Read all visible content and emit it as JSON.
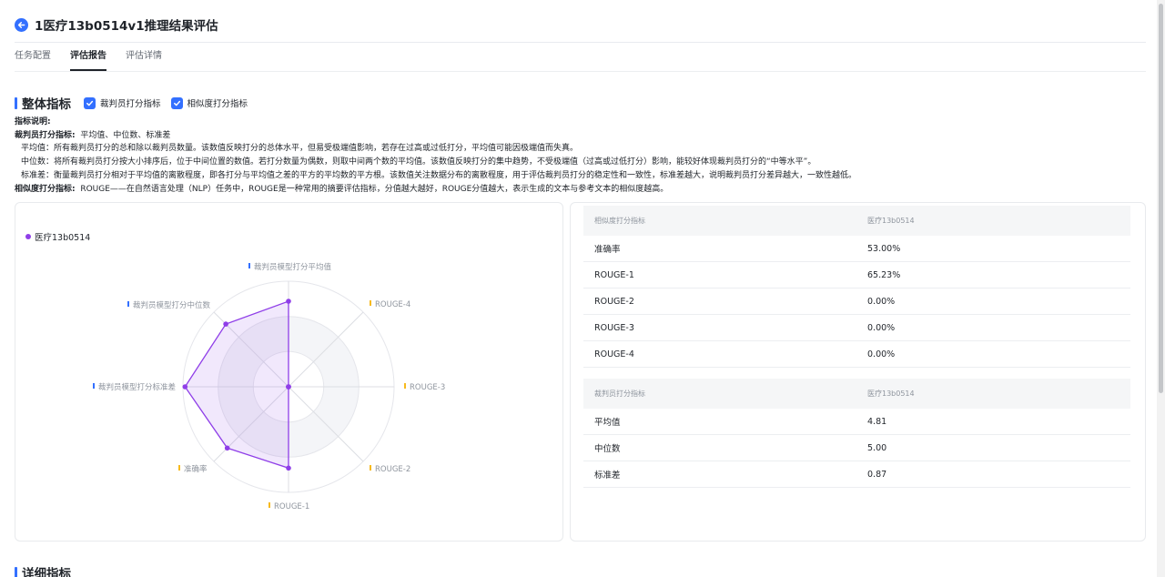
{
  "header": {
    "title": "1医疗13b0514v1推理结果评估"
  },
  "tabs": [
    {
      "label": "任务配置",
      "active": false
    },
    {
      "label": "评估报告",
      "active": true
    },
    {
      "label": "评估详情",
      "active": false
    }
  ],
  "overall": {
    "title": "整体指标",
    "checkboxes": [
      {
        "label": "裁判员打分指标",
        "checked": true
      },
      {
        "label": "相似度打分指标",
        "checked": true
      }
    ]
  },
  "description": {
    "heading": "指标说明:",
    "judge_title": "裁判员打分指标:",
    "judge_list": "平均值、中位数、标准差",
    "mean": "平均值：所有裁判员打分的总和除以裁判员数量。该数值反映打分的总体水平，但易受极端值影响，若存在过高或过低打分，平均值可能因极端值而失真。",
    "median": "中位数：将所有裁判员打分按大小排序后，位于中间位置的数值。若打分数量为偶数，则取中间两个数的平均值。该数值反映打分的集中趋势，不受极端值（过高或过低打分）影响，能较好体现裁判员打分的“中等水平”。",
    "std": "标准差：衡量裁判员打分相对于平均值的离散程度，即各打分与平均值之差的平方的平均数的平方根。该数值关注数据分布的离散程度，用于评估裁判员打分的稳定性和一致性，标准差越大，说明裁判员打分差异越大，一致性越低。",
    "sim_title": "相似度打分指标:",
    "sim_text": "ROUGE——在自然语言处理（NLP）任务中，ROUGE是一种常用的摘要评估指标，分值越大越好，ROUGE分值越大，表示生成的文本与参考文本的相似度越高。"
  },
  "radar": {
    "legend": "医疗13b0514",
    "labels": {
      "mean": "裁判员模型打分平均值",
      "rouge4": "ROUGE-4",
      "rouge3": "ROUGE-3",
      "rouge2": "ROUGE-2",
      "rouge1": "ROUGE-1",
      "acc": "准确率",
      "std": "裁判员模型打分标准差",
      "median": "裁判员模型打分中位数"
    },
    "series_color": "#8f3ee8",
    "judge_color": "#3370ff",
    "sim_color": "#f7ba1e"
  },
  "chart_data": {
    "type": "radar",
    "categories": [
      "裁判员模型打分平均值",
      "ROUGE-4",
      "ROUGE-3",
      "ROUGE-2",
      "ROUGE-1",
      "准确率",
      "裁判员模型打分标准差",
      "裁判员模型打分中位数"
    ],
    "series": [
      {
        "name": "医疗13b0514",
        "values": [
          0.81,
          0.0,
          0.0,
          0.0,
          0.77,
          0.82,
          0.98,
          0.84
        ]
      }
    ],
    "rlim": [
      0,
      1
    ]
  },
  "similarity_table": {
    "headers": [
      "相似度打分指标",
      "医疗13b0514"
    ],
    "rows": [
      [
        "准确率",
        "53.00%"
      ],
      [
        "ROUGE-1",
        "65.23%"
      ],
      [
        "ROUGE-2",
        "0.00%"
      ],
      [
        "ROUGE-3",
        "0.00%"
      ],
      [
        "ROUGE-4",
        "0.00%"
      ]
    ]
  },
  "judge_table": {
    "headers": [
      "裁判员打分指标",
      "医疗13b0514"
    ],
    "rows": [
      [
        "平均值",
        "4.81"
      ],
      [
        "中位数",
        "5.00"
      ],
      [
        "标准差",
        "0.87"
      ]
    ]
  },
  "detail": {
    "title": "详细指标"
  }
}
